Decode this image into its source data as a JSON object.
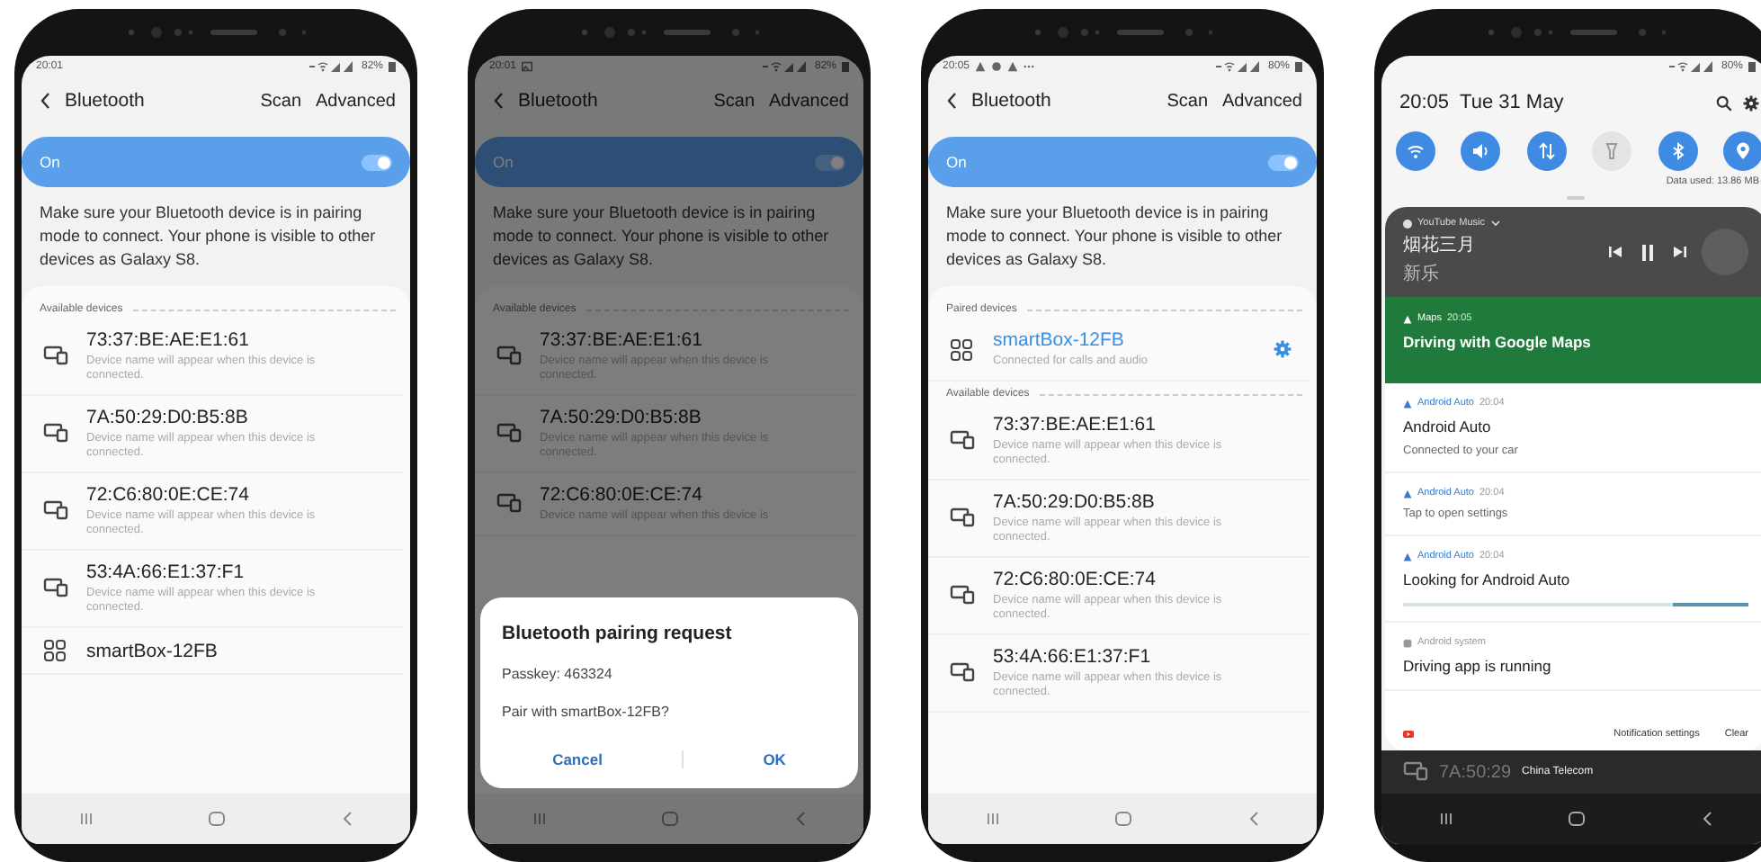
{
  "phones": [
    {
      "kind": "bluetooth",
      "status": {
        "time": "20:01",
        "battery": "82%"
      },
      "header": {
        "title": "Bluetooth",
        "actions": [
          "Scan",
          "Advanced"
        ]
      },
      "master": {
        "label": "On",
        "on": true
      },
      "hint": "Make sure your Bluetooth device is in pairing mode to connect. Your phone is visible to other devices as Galaxy S8.",
      "sections": [
        {
          "title": "Available devices",
          "devices": [
            {
              "kind": "unknown",
              "name": "73:37:BE:AE:E1:61",
              "subtitle": "Device name will appear when this device is connected.",
              "connected": false,
              "settings": false
            },
            {
              "kind": "unknown",
              "name": "7A:50:29:D0:B5:8B",
              "subtitle": "Device name will appear when this device is connected.",
              "connected": false,
              "settings": false
            },
            {
              "kind": "unknown",
              "name": "72:C6:80:0E:CE:74",
              "subtitle": "Device name will appear when this device is connected.",
              "connected": false,
              "settings": false
            },
            {
              "kind": "unknown",
              "name": "53:4A:66:E1:37:F1",
              "subtitle": "Device name will appear when this device is connected.",
              "connected": false,
              "settings": false
            },
            {
              "kind": "speaker",
              "name": "smartBox-12FB",
              "connected": false,
              "settings": false
            }
          ]
        }
      ]
    },
    {
      "kind": "bluetooth",
      "status": {
        "time": "20:01",
        "notification_icons": [
          {
            "kind": "picture"
          }
        ],
        "battery": "82%"
      },
      "header": {
        "title": "Bluetooth",
        "actions": [
          "Scan",
          "Advanced"
        ]
      },
      "master": {
        "label": "On",
        "on": true
      },
      "hint": "Make sure your Bluetooth device is in pairing mode to connect. Your phone is visible to other devices as Galaxy S8.",
      "sections": [
        {
          "title": "Available devices",
          "devices": [
            {
              "kind": "unknown",
              "name": "73:37:BE:AE:E1:61",
              "subtitle": "Device name will appear when this device is connected.",
              "connected": false,
              "settings": false
            },
            {
              "kind": "unknown",
              "name": "7A:50:29:D0:B5:8B",
              "subtitle": "Device name will appear when this device is connected.",
              "connected": false,
              "settings": false
            },
            {
              "kind": "unknown",
              "name": "72:C6:80:0E:CE:74",
              "subtitle": "Device name will appear when this device is",
              "connected": false,
              "settings": false
            }
          ]
        }
      ],
      "dialog": {
        "title": "Bluetooth pairing request",
        "passkey": "Passkey: 463324",
        "question": "Pair with smartBox-12FB?",
        "buttons": [
          "Cancel",
          "OK"
        ]
      }
    },
    {
      "kind": "bluetooth",
      "status": {
        "time": "20:05",
        "notification_icons": [
          {
            "kind": "navigation"
          },
          {
            "kind": "photo"
          },
          {
            "kind": "navigation"
          },
          {
            "kind": "more"
          }
        ],
        "battery": "80%"
      },
      "header": {
        "title": "Bluetooth",
        "actions": [
          "Scan",
          "Advanced"
        ]
      },
      "master": {
        "label": "On",
        "on": true
      },
      "hint": "Make sure your Bluetooth device is in pairing mode to connect. Your phone is visible to other devices as Galaxy S8.",
      "sections": [
        {
          "title": "Paired devices",
          "devices": [
            {
              "kind": "speaker",
              "name": "smartBox-12FB",
              "subtitle": "Connected for calls and audio",
              "connected": true,
              "settings": true
            }
          ]
        },
        {
          "title": "Available devices",
          "devices": [
            {
              "kind": "unknown",
              "name": "73:37:BE:AE:E1:61",
              "subtitle": "Device name will appear when this device is connected.",
              "connected": false,
              "settings": false
            },
            {
              "kind": "unknown",
              "name": "7A:50:29:D0:B5:8B",
              "subtitle": "Device name will appear when this device is connected.",
              "connected": false,
              "settings": false
            },
            {
              "kind": "unknown",
              "name": "72:C6:80:0E:CE:74",
              "subtitle": "Device name will appear when this device is connected.",
              "connected": false,
              "settings": false
            },
            {
              "kind": "unknown",
              "name": "53:4A:66:E1:37:F1",
              "subtitle": "Device name will appear when this device is connected.",
              "connected": false,
              "settings": false
            }
          ]
        }
      ]
    },
    {
      "kind": "notification_shade",
      "status": {
        "battery": "80%"
      },
      "clock": "20:05",
      "date": "Tue 31 May",
      "quick_toggles": [
        {
          "kind": "wifi",
          "on": true
        },
        {
          "kind": "sound",
          "on": true
        },
        {
          "kind": "data",
          "on": true
        },
        {
          "kind": "flashlight",
          "on": false
        },
        {
          "kind": "bluetooth",
          "on": true
        },
        {
          "kind": "location",
          "on": true
        }
      ],
      "data_used": "Data used: 13.86 MB",
      "media": {
        "app": "YouTube Music",
        "title": "烟花三月",
        "artist": "新乐",
        "playing": true
      },
      "notifications": [
        {
          "kind": "navigation",
          "color": "#ffffff",
          "app": "Maps",
          "time": "20:05",
          "title": "Driving with Google Maps",
          "highlighted": true,
          "progress": false
        },
        {
          "kind": "navigation",
          "color": "#3a7bc8",
          "app": "Android Auto",
          "time": "20:04",
          "title": "Android Auto",
          "body": "Connected to your car",
          "highlighted": false,
          "progress": false
        },
        {
          "kind": "navigation",
          "color": "#3a7bc8",
          "app": "Android Auto",
          "time": "20:04",
          "body": "Tap to open settings",
          "highlighted": false,
          "progress": false
        },
        {
          "kind": "navigation",
          "color": "#3a7bc8",
          "app": "Android Auto",
          "time": "20:04",
          "title": "Looking for Android Auto",
          "highlighted": false,
          "progress": true
        },
        {
          "kind": "system",
          "color": "#999999",
          "app": "Android system",
          "title": "Driving app is running",
          "highlighted": false,
          "progress": false
        }
      ],
      "footer": {
        "settings": "Notification settings",
        "clear": "Clear"
      },
      "behind": {
        "name": "7A:50:29",
        "carrier": "China Telecom"
      }
    }
  ]
}
